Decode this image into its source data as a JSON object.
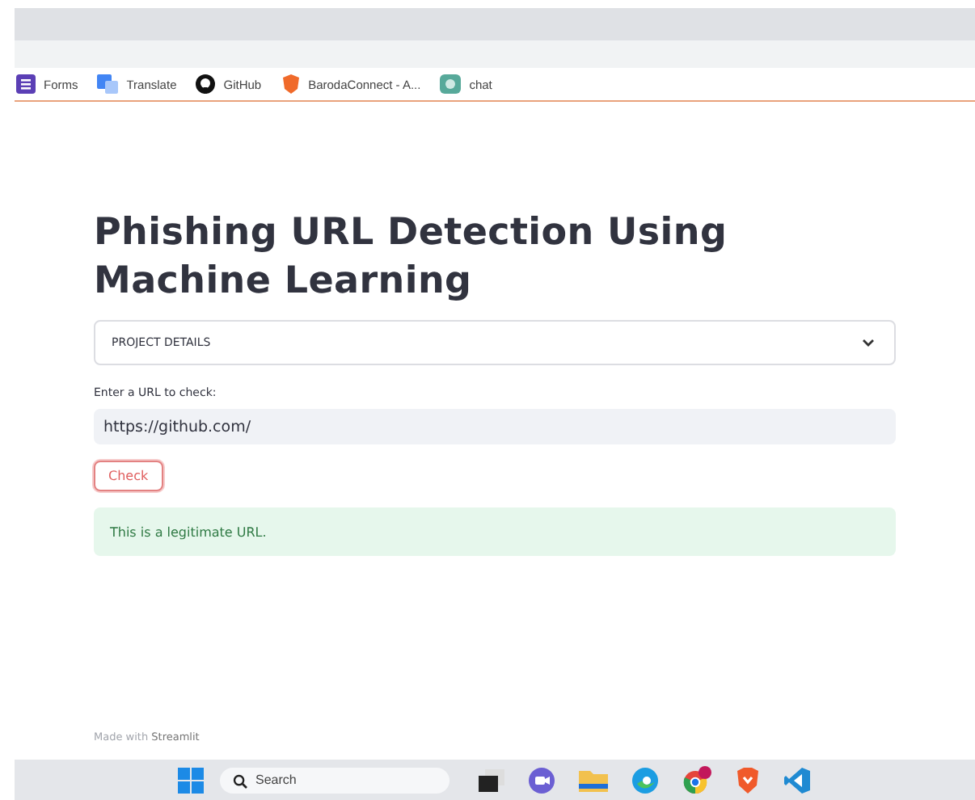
{
  "bookmarks": [
    "Forms",
    "Translate",
    "GitHub",
    "BarodaConnect - A...",
    "chat"
  ],
  "app": {
    "title": "Phishing URL Detection Using Machine Learning",
    "expander": {
      "label": "PROJECT DETAILS",
      "expanded": false
    },
    "input": {
      "label": "Enter a URL to check:",
      "value": "https://github.com/"
    },
    "button": "Check",
    "result": {
      "kind": "success",
      "message": "This is a legitimate URL."
    },
    "footer": "Made with **Streamlit**"
  },
  "taskbar": {
    "search_placeholder": "Search"
  }
}
